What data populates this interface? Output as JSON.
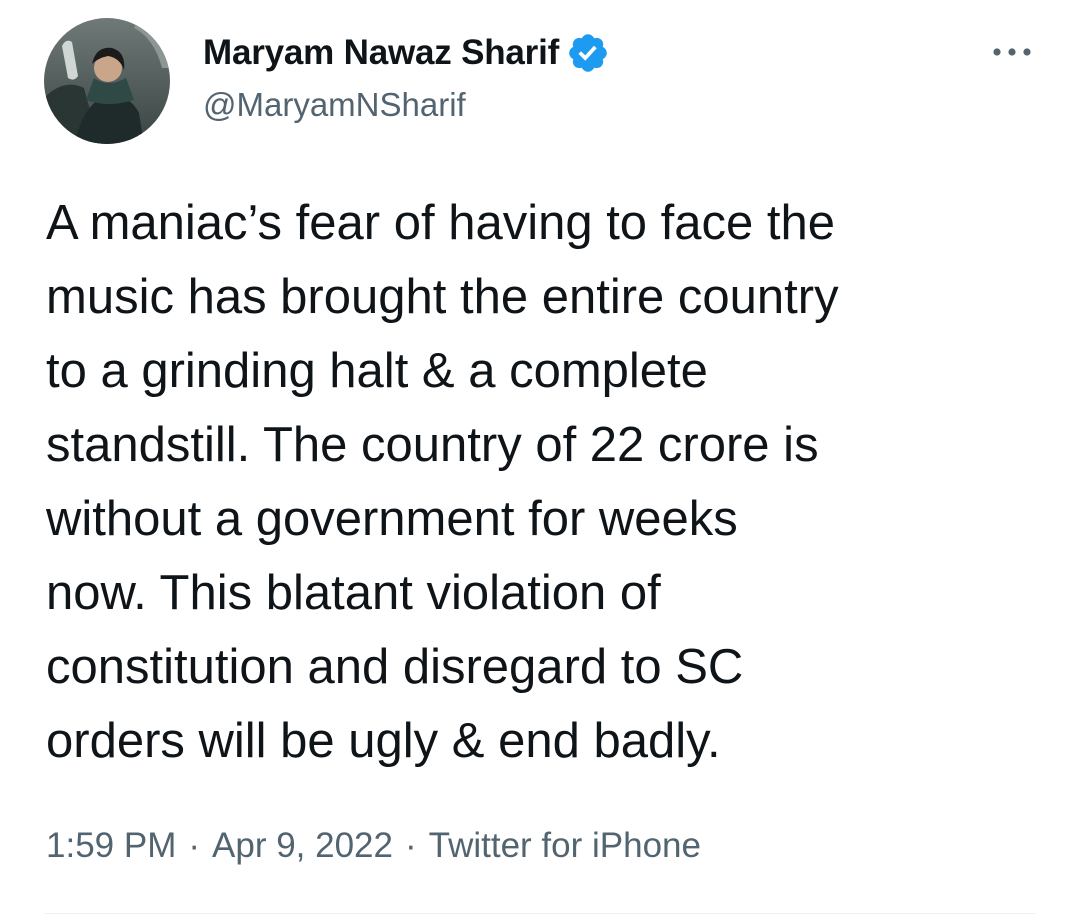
{
  "tweet": {
    "author": {
      "display_name": "Maryam Nawaz Sharif",
      "handle": "@MaryamNSharif",
      "verified": true,
      "verified_color": "#1d9bf0"
    },
    "text": "A maniac’s fear of having to face the\nmusic has brought the entire country\nto a grinding halt & a complete\nstandstill. The country of 22 crore is\nwithout a government for weeks\nnow. This blatant violation of\nconstitution and disregard to SC\norders will be ugly & end badly.",
    "meta": {
      "time": "1:59 PM",
      "separator": "·",
      "date": "Apr 9, 2022",
      "source": "Twitter for iPhone"
    },
    "icons": {
      "more": "more-options-icon",
      "verified": "verified-badge-icon"
    }
  }
}
